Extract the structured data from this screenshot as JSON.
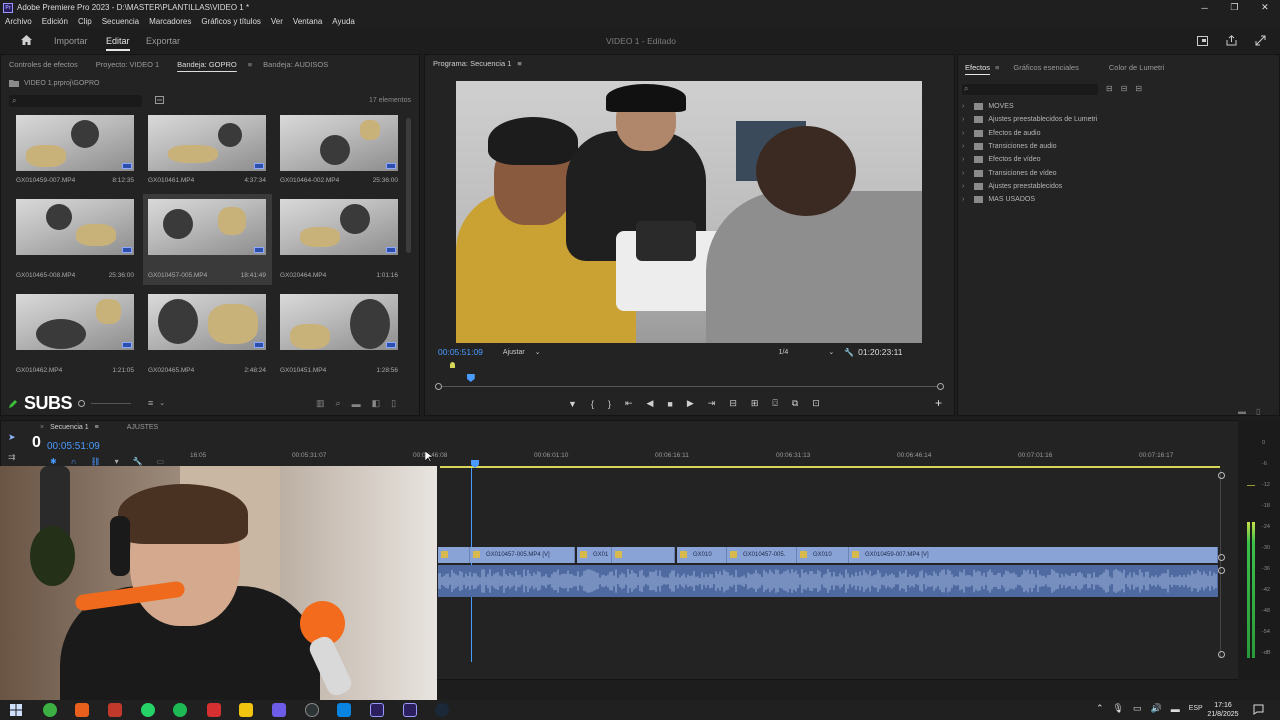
{
  "window": {
    "title": "Adobe Premiere Pro 2023 - D:\\MASTER\\PLANTILLAS\\VIDEO 1 *",
    "controls": [
      "─",
      "❐",
      "✕"
    ]
  },
  "menu": [
    "Archivo",
    "Edición",
    "Clip",
    "Secuencia",
    "Marcadores",
    "Gráficos y títulos",
    "Ver",
    "Ventana",
    "Ayuda"
  ],
  "workspace": {
    "tabs": [
      "Importar",
      "Editar",
      "Exportar"
    ],
    "active": "Editar",
    "center_title": "VIDEO 1 - Editado"
  },
  "project_panel": {
    "tabs": [
      "Controles de efectos",
      "Proyecto: VIDEO 1",
      "Bandeja: GOPRO",
      "Bandeja: AUDISOS"
    ],
    "active_tab": "Bandeja: GOPRO",
    "path": "VIDEO 1.prproj\\GOPRO",
    "item_count": "17 elementos",
    "clips": [
      {
        "name": "GX010459-007.MP4",
        "duration": "8:12:35"
      },
      {
        "name": "GX010461.MP4",
        "duration": "4:37:34"
      },
      {
        "name": "GX010464-002.MP4",
        "duration": "25:36:00"
      },
      {
        "name": "GX010465-008.MP4",
        "duration": "25:36:00"
      },
      {
        "name": "GX010457-005.MP4",
        "duration": "18:41:49"
      },
      {
        "name": "GX020464.MP4",
        "duration": "1:01:16"
      },
      {
        "name": "GX010462.MP4",
        "duration": "1:21:05"
      },
      {
        "name": "GX020465.MP4",
        "duration": "2:48:24"
      },
      {
        "name": "GX010451.MP4",
        "duration": "1:28:56"
      }
    ],
    "selected_index": 4,
    "overlay_text": "SUBS"
  },
  "program_monitor": {
    "title": "Programa: Secuencia 1",
    "timecode": "00:05:51:09",
    "fit": "Ajustar",
    "resolution": "1/4",
    "duration": "01:20:23:11",
    "playhead_fraction": 0.065
  },
  "effects_panel": {
    "tabs": [
      "Efectos",
      "Gráficos esenciales",
      "Color de Lumetri"
    ],
    "active_tab": "Efectos",
    "folders": [
      "MOVES",
      "Ajustes preestablecidos de Lumetri",
      "Efectos de audio",
      "Transiciones de audio",
      "Efectos de vídeo",
      "Transiciones de vídeo",
      "Ajustes preestablecidos",
      "MAS USADOS"
    ]
  },
  "timeline": {
    "tabs": [
      "Secuencia 1",
      "AJUSTES"
    ],
    "timecode": "00:05:51:09",
    "ruler": [
      "16:05",
      "00:05:31:07",
      "00:05:46:08",
      "00:06:01:10",
      "00:06:16:11",
      "00:06:31:13",
      "00:06:46:14",
      "00:07:01:16",
      "00:07:16:17"
    ],
    "video_clips": [
      {
        "label": ""
      },
      {
        "label": "GX010457-005.MP4 [V]"
      },
      {
        "label": "GX01"
      },
      {
        "label": ""
      },
      {
        "label": "GX010"
      },
      {
        "label": "GX010457-005."
      },
      {
        "label": "GX010"
      },
      {
        "label": "GX010459-007.MP4 [V]"
      }
    ]
  },
  "audio_meter": {
    "labels": [
      "0",
      "-6",
      "-12",
      "-18",
      "-24",
      "-30",
      "-36",
      "-42",
      "-48",
      "-54",
      "-dB"
    ]
  },
  "taskbar": {
    "time": "17:16",
    "date": "21/8/2025",
    "lang": "ESP"
  },
  "colors": {
    "accent": "#2d8ceb",
    "clip_video": "#8aa3d6",
    "clip_audio": "#4e6aa0",
    "timecode": "#4a9bff",
    "work_area": "#d6d65a"
  }
}
